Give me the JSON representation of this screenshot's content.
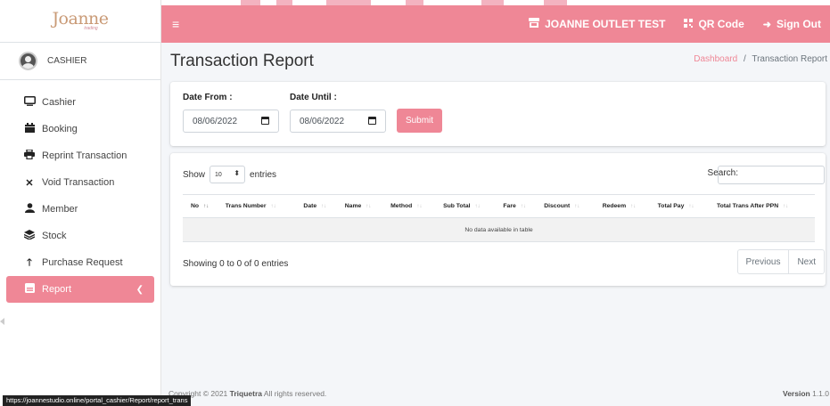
{
  "brand": {
    "logo": "Joanne",
    "sub": "trading"
  },
  "user": {
    "name": "CASHIER"
  },
  "sidebar": {
    "items": [
      {
        "label": "Cashier",
        "icon": "monitor-icon"
      },
      {
        "label": "Booking",
        "icon": "calendar-icon"
      },
      {
        "label": "Reprint Transaction",
        "icon": "printer-icon"
      },
      {
        "label": "Void Transaction",
        "icon": "close-icon"
      },
      {
        "label": "Member",
        "icon": "user-icon"
      },
      {
        "label": "Stock",
        "icon": "layers-icon"
      },
      {
        "label": "Purchase Request",
        "icon": "arrow-up-icon"
      },
      {
        "label": "Report",
        "icon": "report-icon"
      }
    ]
  },
  "navbar": {
    "outlet": "JOANNE OUTLET TEST",
    "qr": "QR Code",
    "signout": "Sign Out"
  },
  "page": {
    "title": "Transaction Report",
    "crumb_home": "Dashboard",
    "crumb_sep": "/",
    "crumb_current": "Transaction Report"
  },
  "filter": {
    "date_from_label": "Date From :",
    "date_until_label": "Date Until :",
    "date_from": "08/06/2022",
    "date_until": "08/06/2022",
    "submit": "Submit"
  },
  "table": {
    "show_label": "Show",
    "entries_label": "entries",
    "page_size": "10",
    "search_label": "Search:",
    "columns": [
      "No",
      "Trans Number",
      "Date",
      "Name",
      "Method",
      "Sub Total",
      "Fare",
      "Discount",
      "Redeem",
      "Total Pay",
      "Total Trans After PPN"
    ],
    "empty": "No data available in table",
    "info": "Showing 0 to 0 of 0 entries",
    "prev": "Previous",
    "next": "Next"
  },
  "footer": {
    "copy_prefix": "Copyright © 2021 ",
    "copy_brand": "Triquetra",
    "copy_suffix": " All rights reserved.",
    "version_label": "Version",
    "version": "1.1.0"
  },
  "status_url": "https://joannestudio.online/portal_cashier/Report/report_trans",
  "colors": {
    "accent": "#ef8796",
    "brand": "#c99a76"
  }
}
